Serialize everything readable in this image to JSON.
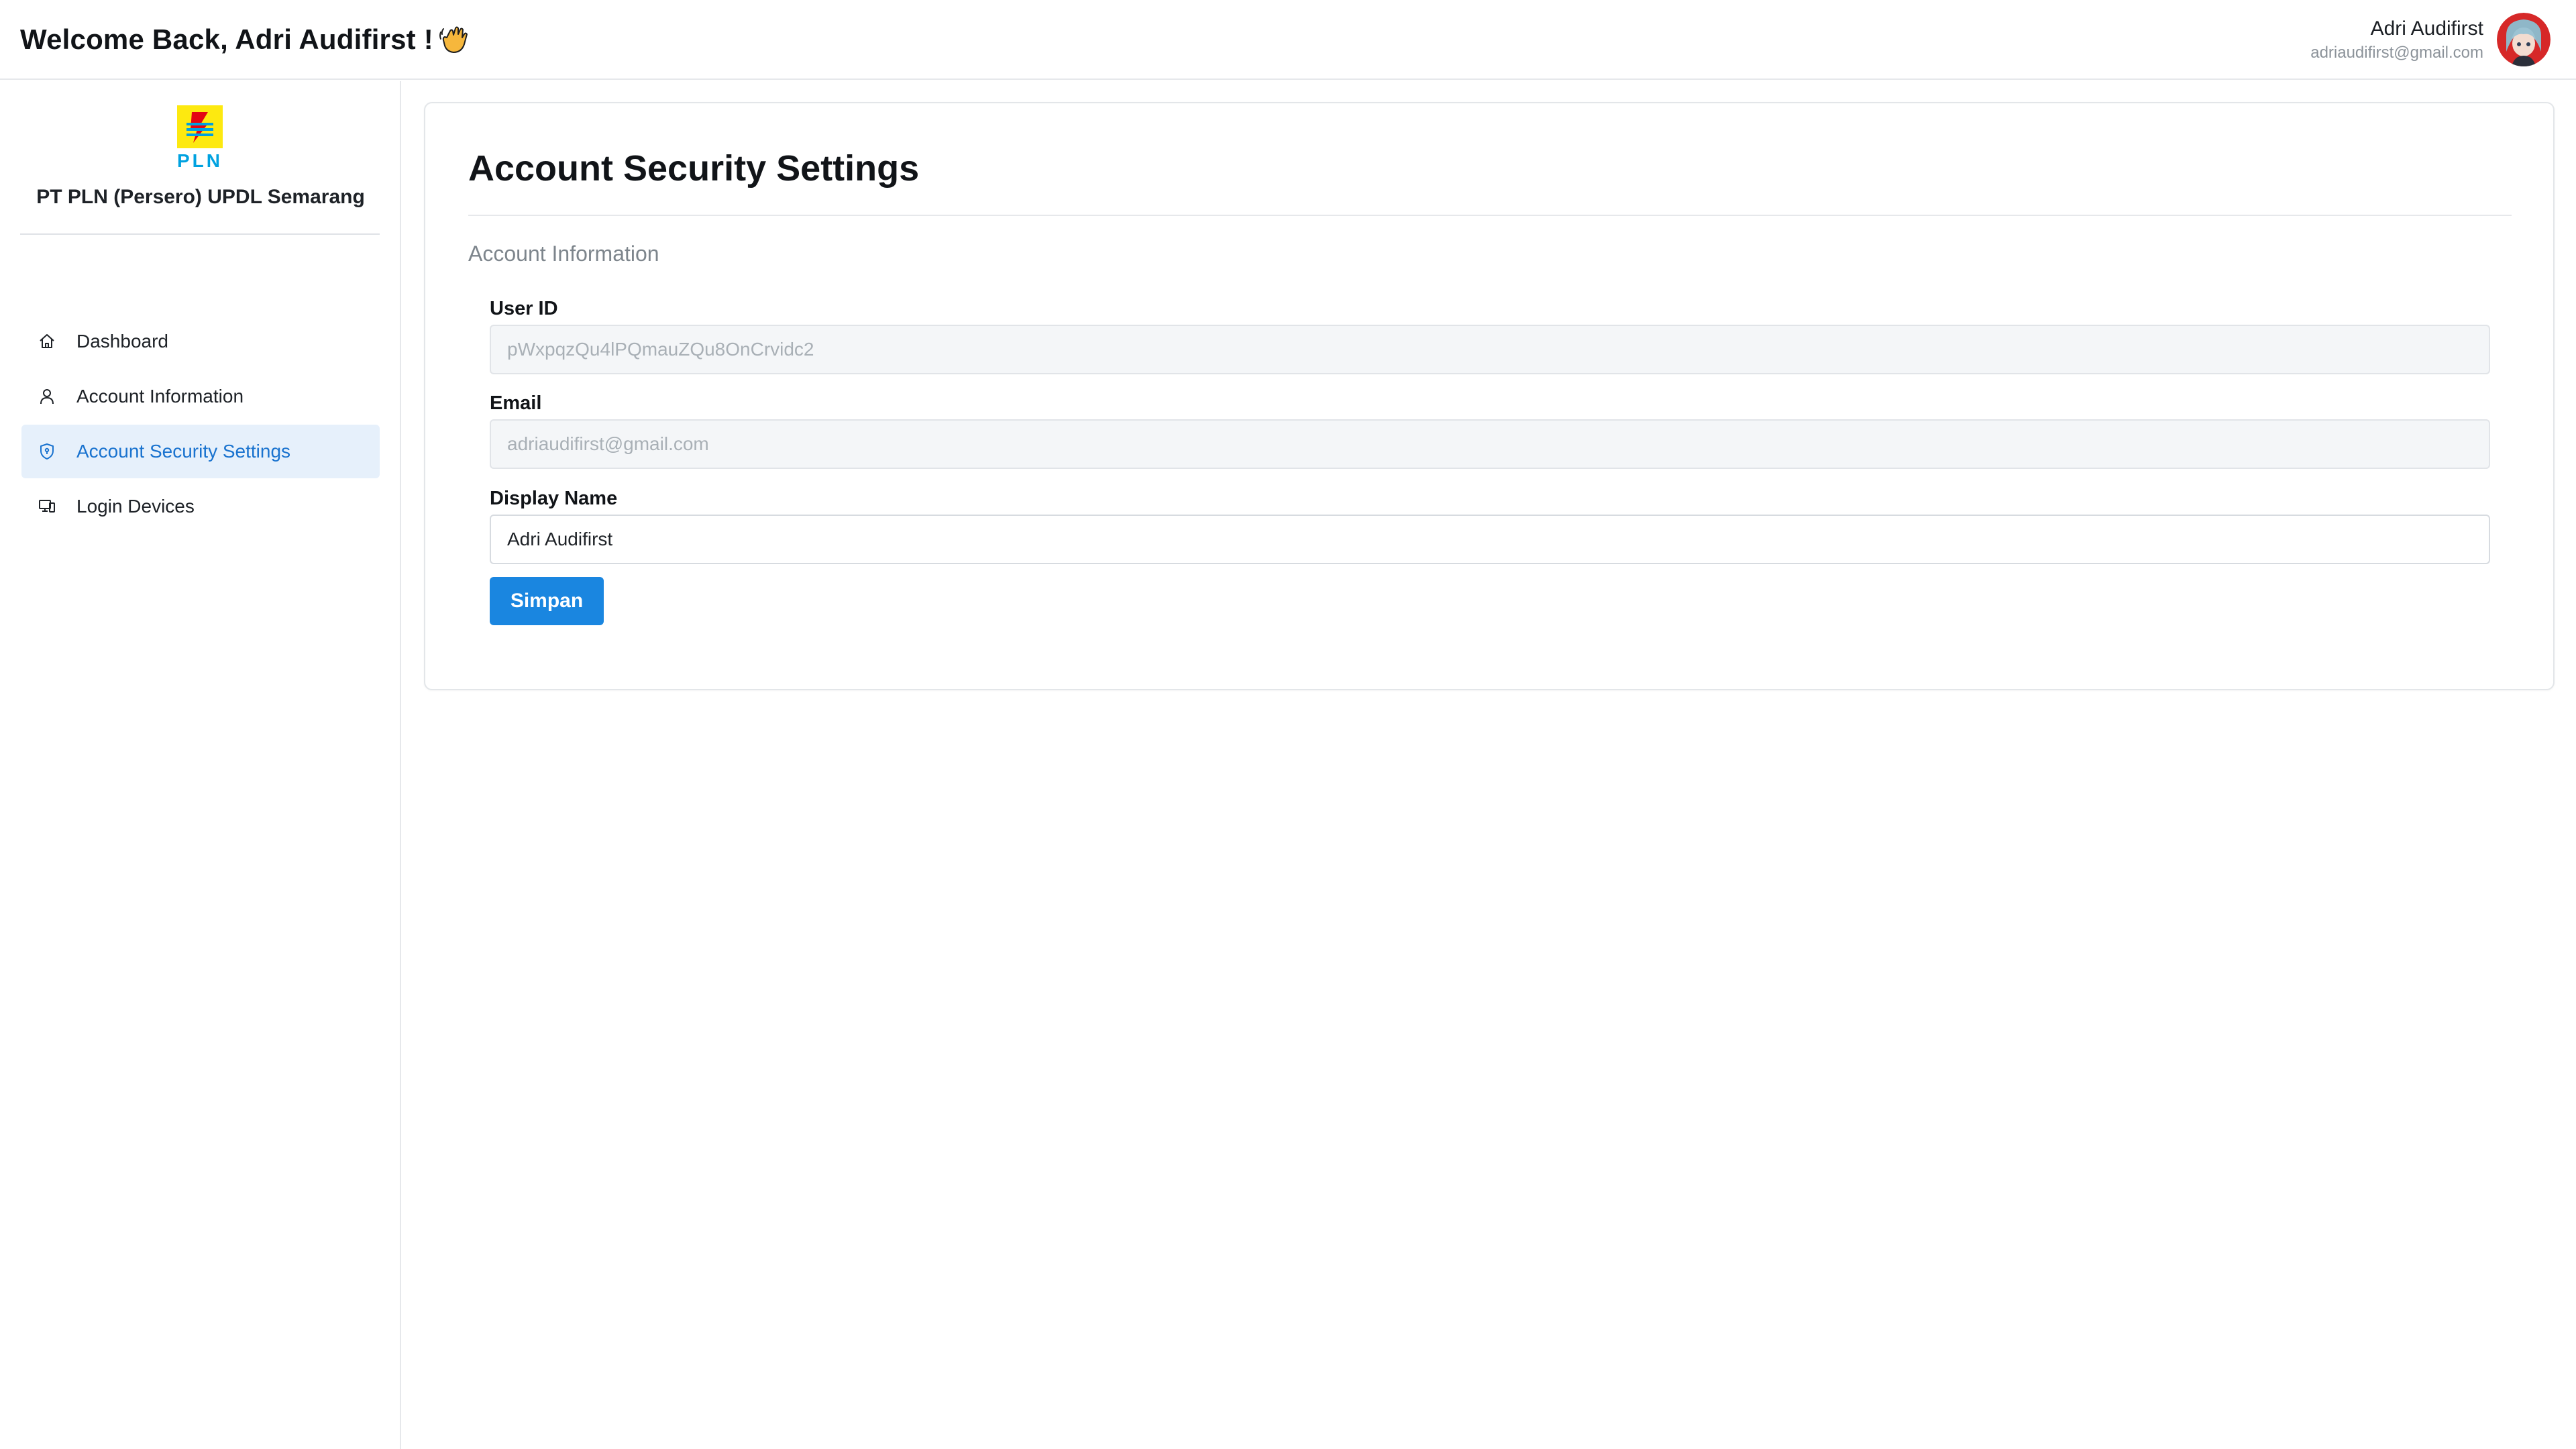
{
  "header": {
    "welcome_text": "Welcome Back, Adri Audifirst !",
    "wave_icon": "waving-hand-icon",
    "user_name": "Adri Audifirst",
    "user_email": "adriaudifirst@gmail.com"
  },
  "sidebar": {
    "logo_text": "PLN",
    "org_name": "PT PLN (Persero) UPDL Semarang",
    "items": [
      {
        "label": "Dashboard",
        "icon": "home-icon",
        "active": false
      },
      {
        "label": "Account Information",
        "icon": "user-icon",
        "active": false
      },
      {
        "label": "Account Security Settings",
        "icon": "shield-icon",
        "active": true
      },
      {
        "label": "Login Devices",
        "icon": "devices-icon",
        "active": false
      }
    ]
  },
  "main": {
    "title": "Account Security Settings",
    "section_title": "Account Information",
    "fields": {
      "user_id": {
        "label": "User ID",
        "value": "pWxpqzQu4lPQmauZQu8OnCrvidc2"
      },
      "email": {
        "label": "Email",
        "value": "adriaudifirst@gmail.com"
      },
      "display_name": {
        "label": "Display Name",
        "value": "Adri Audifirst"
      }
    },
    "save_label": "Simpan"
  },
  "colors": {
    "accent": "#1a86e0",
    "active_nav_bg": "#e6f0fb",
    "active_nav_text": "#1a73cf",
    "logo_yellow": "#fde910",
    "logo_blue": "#00a2e0",
    "logo_red": "#e30613"
  }
}
